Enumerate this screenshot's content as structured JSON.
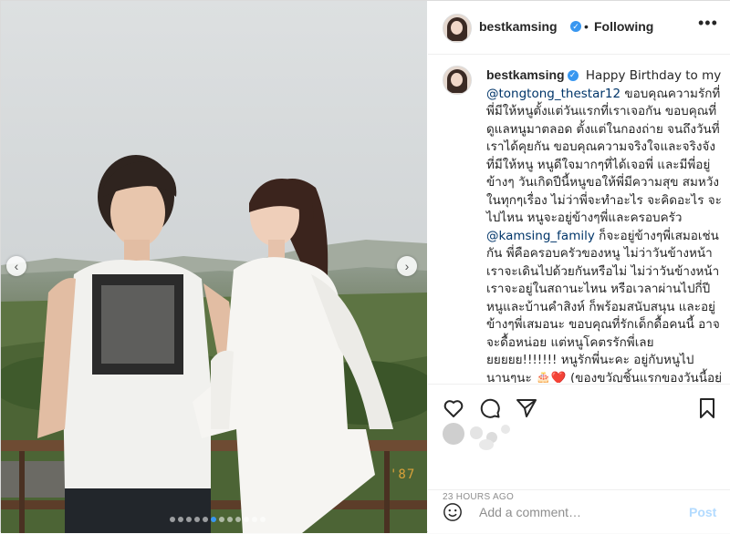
{
  "header": {
    "username": "bestkamsing",
    "separator": "•",
    "follow_status": "Following",
    "more_label": "•••"
  },
  "photo": {
    "film_date": "'87",
    "carousel_count": 12,
    "carousel_active": 6
  },
  "caption": {
    "username": "bestkamsing",
    "line1": "Happy Birthday to my",
    "mention1": "@tongtong_thestar12",
    "body1": "ขอบคุณความรักที่พี่มีให้หนูตั้งแต่วันแรกที่เราเจอกัน ขอบคุณที่ดูแลหนูมาตลอด ตั้งแต่ในกองถ่าย จนถึงวันที่เราได้คุยกัน ขอบคุณความจริงใจและจริงจังที่มีให้หนู หนูดีใจมากๆที่ได้เจอพี่ และมีพี่อยู่ข้างๆ วันเกิดปีนี้หนูขอให้พี่มีความสุข สมหวังในทุกๆเรื่อง ไม่ว่าพี่จะทำอะไร จะคิดอะไร จะไปไหน หนูจะอยู่ข้างๆพี่และครอบครัว",
    "mention2": "@kamsing_family",
    "body2": "ก็จะอยู่ข้างๆพี่เสมอเช่นกัน พี่คือครอบครัวของหนู ไม่ว่าวันข้างหน้าเราจะเดินไปด้วยกันหรือไม่ ไม่ว่าวันข้างหน้าเราจะอยู่ในสถานะไหน หรือเวลาผ่านไปกี่ปี หนูและบ้านคำสิงห์ ก็พร้อมสนับสนุน และอยู่ข้างๆพี่เสมอนะ ขอบคุณที่รักเด็กดื้อคนนี้ อาจจะดื้อหน่อย แต่หนูโคตรรักพี่เลยยยยยย!!!!!!! หนูรักพี่นะคะ อยู่กับหนูไปนานๆนะ",
    "emoji": "🎂❤️",
    "body3": "(ของขวัญชิ้นแรกของวันนี้อยู่ในyoutubeนะคะ)"
  },
  "meta": {
    "time_ago": "23 HOURS AGO"
  },
  "comment": {
    "placeholder": "Add a comment…",
    "post_label": "Post"
  },
  "colors": {
    "accent": "#3897f0",
    "mention": "#003569",
    "post_disabled": "#b3dbff"
  }
}
